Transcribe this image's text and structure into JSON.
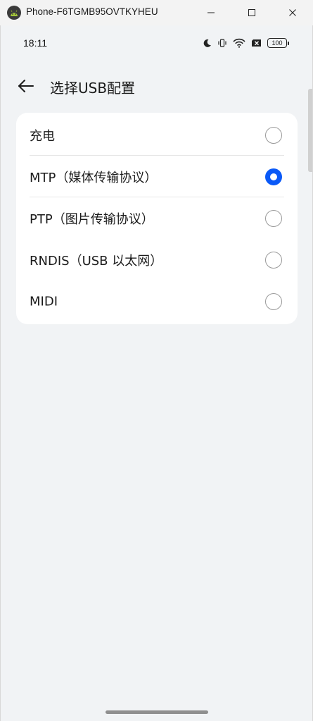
{
  "window": {
    "title": "Phone-F6TGMB95OVTKYHEU",
    "minimize_glyph": "—",
    "maximize_glyph": "☐",
    "close_glyph": "✕"
  },
  "statusbar": {
    "time": "18:11",
    "icons": [
      "moon-icon",
      "vibrate-icon",
      "wifi-icon",
      "sim-x-icon"
    ],
    "battery": "100"
  },
  "header": {
    "title": "选择USB配置"
  },
  "options": [
    {
      "label": "充电",
      "checked": false
    },
    {
      "label": "MTP（媒体传输协议）",
      "checked": true
    },
    {
      "label": "PTP（图片传输协议）",
      "checked": false
    },
    {
      "label": "RNDIS（USB 以太网）",
      "checked": false
    },
    {
      "label": "MIDI",
      "checked": false
    }
  ],
  "colors": {
    "accent": "#0a59f7",
    "background": "#f1f3f5",
    "card": "#ffffff"
  }
}
